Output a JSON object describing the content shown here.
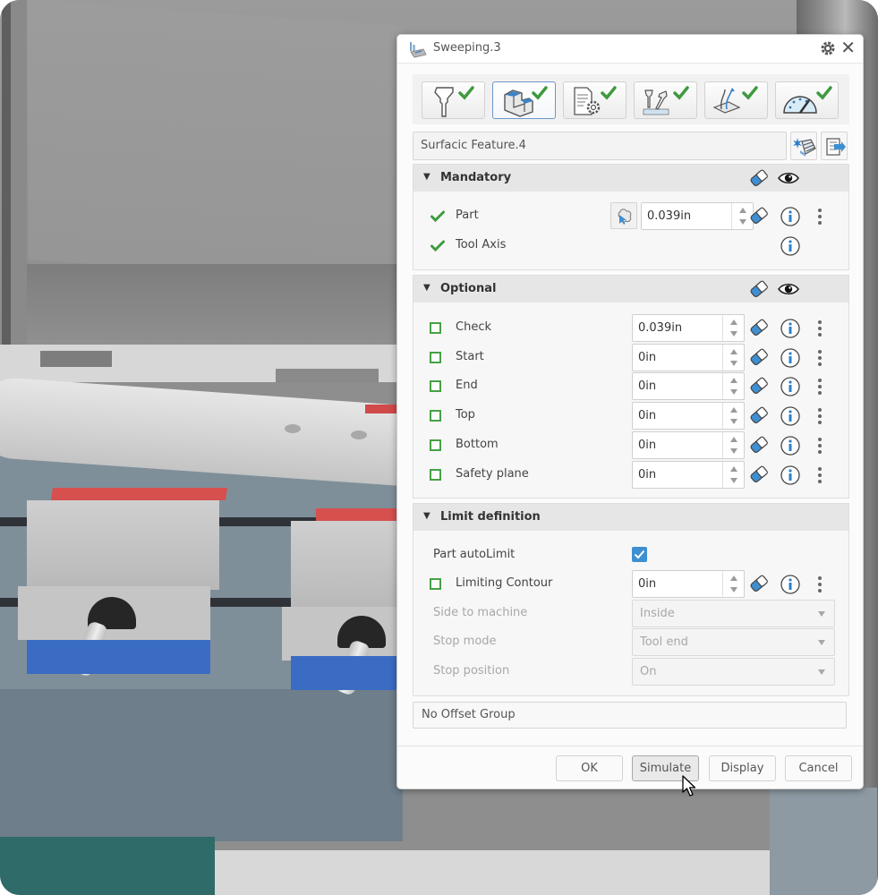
{
  "dialog": {
    "title": "Sweeping.3",
    "title_icon": "sweeping-operation-icon",
    "tabs": [
      {
        "name": "tool",
        "icon": "tool-icon",
        "status": "complete",
        "selected": false
      },
      {
        "name": "geometry",
        "icon": "geometry-icon",
        "status": "complete",
        "selected": true
      },
      {
        "name": "strategy",
        "icon": "strategy-parameters-icon",
        "status": "complete",
        "selected": false
      },
      {
        "name": "macros",
        "icon": "macros-icon",
        "status": "complete",
        "selected": false
      },
      {
        "name": "feeds",
        "icon": "feeds-speeds-icon",
        "status": "complete",
        "selected": false
      },
      {
        "name": "speed",
        "icon": "speed-gauge-icon",
        "status": "complete",
        "selected": false
      }
    ],
    "feature": {
      "value": "Surfacic Feature.4"
    },
    "sections": {
      "mandatory": {
        "title": "Mandatory",
        "rows": [
          {
            "label": "Part",
            "status": "valid",
            "value": "0.039in"
          },
          {
            "label": "Tool Axis",
            "status": "valid"
          }
        ]
      },
      "optional": {
        "title": "Optional",
        "rows": [
          {
            "label": "Check",
            "status": "empty",
            "value": "0.039in"
          },
          {
            "label": "Start",
            "status": "empty",
            "value": "0in"
          },
          {
            "label": "End",
            "status": "empty",
            "value": "0in"
          },
          {
            "label": "Top",
            "status": "empty",
            "value": "0in"
          },
          {
            "label": "Bottom",
            "status": "empty",
            "value": "0in"
          },
          {
            "label": "Safety plane",
            "status": "empty",
            "value": "0in"
          }
        ]
      },
      "limit": {
        "title": "Limit definition",
        "part_autolimit": {
          "label": "Part autoLimit",
          "checked": true
        },
        "limiting_contour": {
          "label": "Limiting Contour",
          "status": "empty",
          "value": "0in"
        },
        "side_to_machine": {
          "label": "Side to machine",
          "value": "Inside",
          "disabled": true
        },
        "stop_mode": {
          "label": "Stop mode",
          "value": "Tool end",
          "disabled": true
        },
        "stop_position": {
          "label": "Stop position",
          "value": "On",
          "disabled": true
        }
      }
    },
    "offset_group": "No Offset Group",
    "buttons": {
      "ok": "OK",
      "simulate": "Simulate",
      "display": "Display",
      "cancel": "Cancel"
    },
    "hovered_button": "simulate"
  },
  "colors": {
    "check_green": "#46a146",
    "accent_blue": "#3d8fd1",
    "selected_tab_border": "#6d95c9",
    "vise_red": "#d5504e",
    "vise_blue": "#3a6cc4"
  }
}
